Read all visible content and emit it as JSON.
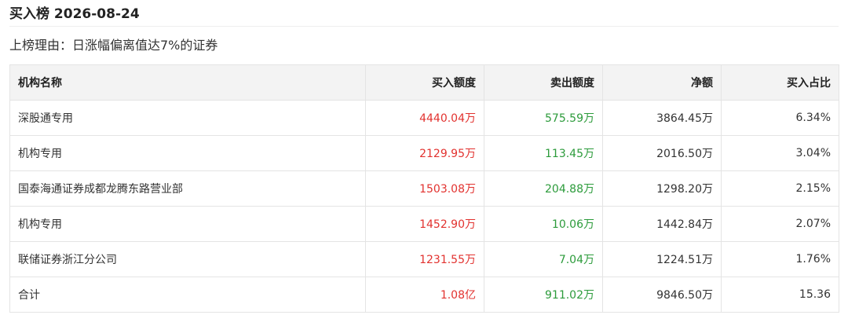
{
  "header": {
    "title": "买入榜 2026-08-24",
    "reason": "上榜理由：日涨幅偏离值达7%的证券"
  },
  "colors": {
    "buy": "#e2322f",
    "sell": "#2c9b3b",
    "header_bg": "#f3f3f3",
    "border": "#e4e4e4"
  },
  "table": {
    "columns": [
      "机构名称",
      "买入额度",
      "卖出额度",
      "净额",
      "买入占比"
    ],
    "rows": [
      {
        "name": "深股通专用",
        "buy": "4440.04万",
        "sell": "575.59万",
        "net": "3864.45万",
        "ratio": "6.34%"
      },
      {
        "name": "机构专用",
        "buy": "2129.95万",
        "sell": "113.45万",
        "net": "2016.50万",
        "ratio": "3.04%"
      },
      {
        "name": "国泰海通证券成都龙腾东路营业部",
        "buy": "1503.08万",
        "sell": "204.88万",
        "net": "1298.20万",
        "ratio": "2.15%"
      },
      {
        "name": "机构专用",
        "buy": "1452.90万",
        "sell": "10.06万",
        "net": "1442.84万",
        "ratio": "2.07%"
      },
      {
        "name": "联储证券浙江分公司",
        "buy": "1231.55万",
        "sell": "7.04万",
        "net": "1224.51万",
        "ratio": "1.76%"
      },
      {
        "name": "合计",
        "buy": "1.08亿",
        "sell": "911.02万",
        "net": "9846.50万",
        "ratio": "15.36"
      }
    ]
  }
}
